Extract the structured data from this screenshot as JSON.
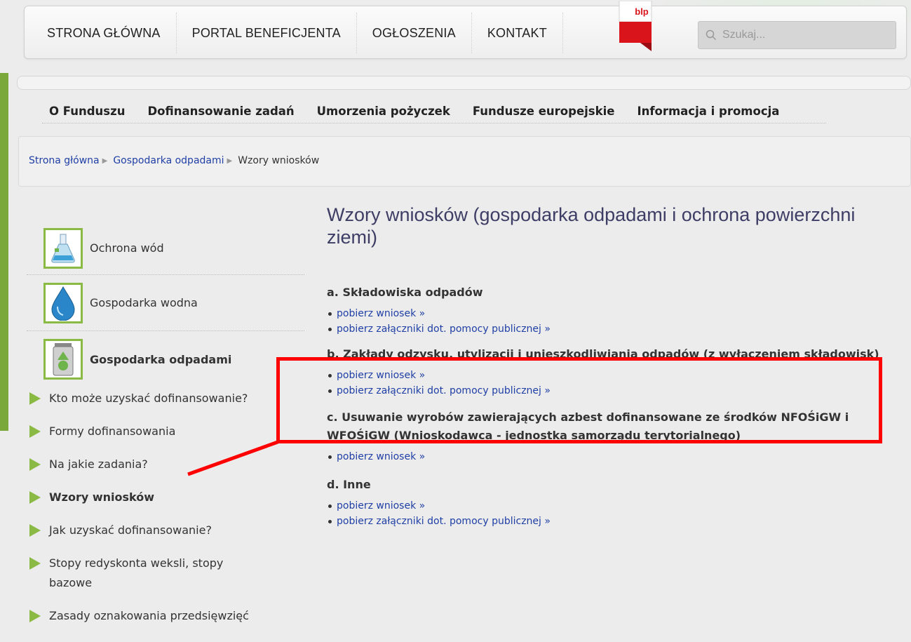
{
  "top_nav": {
    "items": [
      "STRONA GŁÓWNA",
      "PORTAL BENEFICJENTA",
      "OGŁOSZENIA",
      "KONTAKT"
    ],
    "blp_label": "blp"
  },
  "search": {
    "placeholder": "Szukaj..."
  },
  "main_nav": {
    "items": [
      "O Funduszu",
      "Dofinansowanie zadań",
      "Umorzenia pożyczek",
      "Fundusze europejskie",
      "Informacja i promocja"
    ]
  },
  "breadcrumb": {
    "items": [
      "Strona główna",
      "Gospodarka odpadami"
    ],
    "current": "Wzory wniosków"
  },
  "sidebar": {
    "items": [
      {
        "label": "Ochrona wód",
        "icon": "flask-icon"
      },
      {
        "label": "Gospodarka wodna",
        "icon": "water-drop-icon"
      },
      {
        "label": "Gospodarka odpadami",
        "icon": "waste-bin-icon"
      }
    ],
    "sub_items": [
      "Kto może uzyskać dofinansowanie?",
      "Formy dofinansowania",
      "Na jakie zadania?",
      "Wzory wniosków",
      "Jak uzyskać dofinansowanie?",
      "Stopy redyskonta weksli, stopy bazowe",
      "Zasady oznakowania przedsięwzięć"
    ]
  },
  "content": {
    "title": "Wzory wniosków (gospodarka odpadami i ochrona powierzchni ziemi)",
    "sections": [
      {
        "heading": "a. Składowiska odpadów",
        "links": [
          "pobierz wniosek »",
          "pobierz załączniki dot. pomocy publicznej »"
        ]
      },
      {
        "heading": "b. Zakłady odzysku, utylizacji i unieszkodliwiania odpadów (z wyłączeniem składowisk)",
        "links": [
          "pobierz wniosek »",
          "pobierz załączniki dot. pomocy publicznej »"
        ]
      },
      {
        "heading": "c. Usuwanie wyrobów zawierających azbest dofinansowane ze środków NFOŚiGW i WFOŚiGW (Wnioskodawca - jednostka samorządu terytorialnego)",
        "links": [
          "pobierz wniosek »"
        ]
      },
      {
        "heading": "d. Inne",
        "links": [
          "pobierz wniosek »",
          "pobierz załączniki dot. pomocy publicznej »"
        ]
      }
    ]
  },
  "colors": {
    "accent_green": "#8aba44",
    "link_blue": "#1f3fa5",
    "title_color": "#3d3d66",
    "annotation_red": "#ff0000",
    "blp_red": "#d9141b"
  }
}
